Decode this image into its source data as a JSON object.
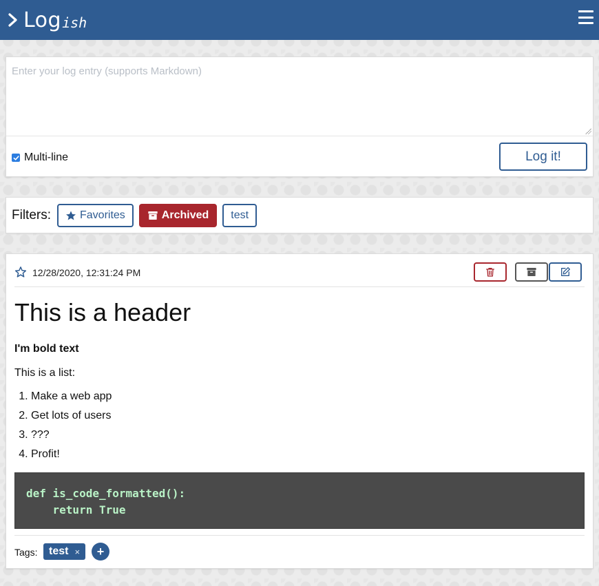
{
  "app": {
    "logo_main": "Log",
    "logo_sub": "ish"
  },
  "entry_form": {
    "placeholder": "Enter your log entry (supports Markdown)",
    "multiline_label": "Multi-line",
    "multiline_checked": true,
    "submit_label": "Log it!"
  },
  "filters": {
    "label": "Filters:",
    "items": [
      {
        "label": "Favorites",
        "style": "outline",
        "icon": "star-icon"
      },
      {
        "label": "Archived",
        "style": "active-danger",
        "icon": "archive-icon"
      },
      {
        "label": "test",
        "style": "outline"
      }
    ]
  },
  "log_entry": {
    "timestamp": "12/28/2020, 12:31:24 PM",
    "favorite": false,
    "actions": {
      "delete": "trash-icon",
      "archive": "archive-icon",
      "edit": "edit-icon"
    },
    "content": {
      "header": "This is a header",
      "bold_text": "I'm bold text",
      "paragraph": "This is a list:",
      "list": [
        "Make a web app",
        "Get lots of users",
        "???",
        "Profit!"
      ],
      "code": "def is_code_formatted():\n    return True"
    },
    "tags_label": "Tags:",
    "tags": [
      {
        "label": "test",
        "remove": "×"
      }
    ],
    "add_tag": "+"
  },
  "colors": {
    "primary": "#2f5c92",
    "danger": "#a8262d",
    "code_bg": "#4a4a4a",
    "code_fg": "#b9f2c6"
  }
}
